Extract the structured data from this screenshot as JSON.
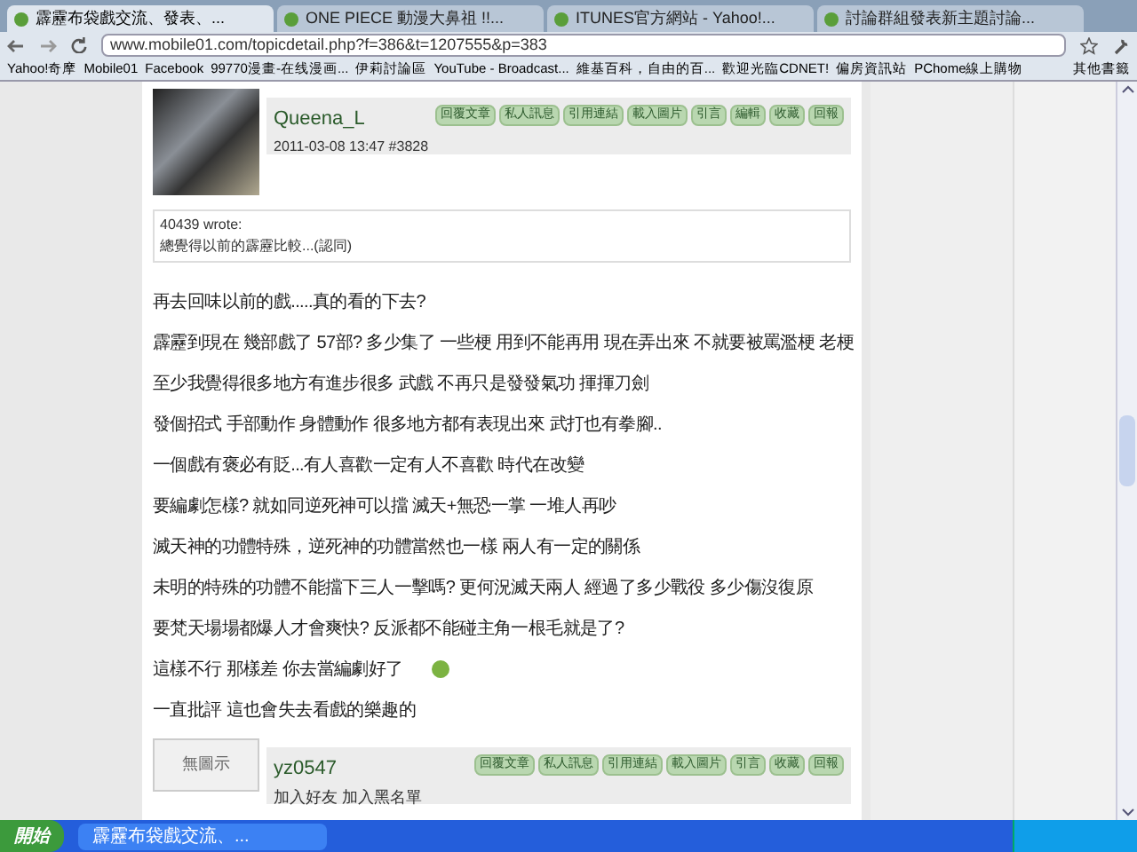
{
  "tabs": [
    {
      "label": "霹靂布袋戲交流、發表、...",
      "selected": true
    },
    {
      "label": "ONE PIECE 動漫大鼻祖 !!...",
      "selected": false
    },
    {
      "label": "ITUNES官方網站 - Yahoo!...",
      "selected": false
    },
    {
      "label": "討論群組發表新主題討論...",
      "selected": false
    }
  ],
  "address": "www.mobile01.com/topicdetail.php?f=386&t=1207555&p=383",
  "bookmarks": [
    {
      "label": "Yahoo!奇摩"
    },
    {
      "label": "Mobile01"
    },
    {
      "label": "Facebook"
    },
    {
      "label": "99770漫畫-在线漫画..."
    },
    {
      "label": "伊莉討論區"
    },
    {
      "label": "YouTube - Broadcast..."
    },
    {
      "label": "維基百科，自由的百..."
    },
    {
      "label": "歡迎光臨CDNET!"
    },
    {
      "label": "偏房資訊站"
    },
    {
      "label": "PChome線上購物"
    }
  ],
  "other_bookmarks": "其他書籤",
  "posts": [
    {
      "author": "Queena_L",
      "meta": "2011-03-08 13:47  #3828",
      "has_avatar": true,
      "actions": [
        "回覆文章",
        "私人訊息",
        "引用連結",
        "載入圖片",
        "引言",
        "編輯",
        "收藏",
        "回報"
      ],
      "quote": {
        "by": "40439 wrote:",
        "text": "總覺得以前的霹靂比較...(認同)"
      },
      "paragraphs": [
        {
          "text": "再去回味以前的戲.....真的看的下去?"
        },
        {
          "text": "霹靂到現在 幾部戲了 57部? 多少集了 一些梗 用到不能再用 現在弄出來 不就要被罵濫梗 老梗"
        },
        {
          "text": "至少我覺得很多地方有進步很多 武戲 不再只是發發氣功 揮揮刀劍"
        },
        {
          "text": "發個招式 手部動作 身體動作 很多地方都有表現出來 武打也有拳腳.."
        },
        {
          "text": "一個戲有褒必有貶...有人喜歡一定有人不喜歡 時代在改變"
        },
        {
          "text": "要編劇怎樣? 就如同逆死神可以擋 滅天+無恐一掌 一堆人再吵"
        },
        {
          "text": "滅天神的功體特殊，逆死神的功體當然也一樣 兩人有一定的關係"
        },
        {
          "text": "未明的特殊的功體不能擋下三人一擊嗎? 更何況滅天兩人 經過了多少戰役 多少傷沒復原"
        },
        {
          "text": "要梵天場場都爆人才會爽快? 反派都不能碰主角一根毛就是了?"
        },
        {
          "text": "這樣不行 那樣差 你去當編劇好了",
          "emoticon": true
        },
        {
          "text": "一直批評 這也會失去看戲的樂趣的"
        }
      ]
    },
    {
      "author": "yz0547",
      "links": "加入好友 加入黑名單",
      "has_avatar": false,
      "avatar_text": "無圖示",
      "actions": [
        "回覆文章",
        "私人訊息",
        "引用連結",
        "載入圖片",
        "引言",
        "收藏",
        "回報"
      ]
    }
  ],
  "taskbar": {
    "start": "開始",
    "window": "霹靂布袋戲交流、..."
  }
}
